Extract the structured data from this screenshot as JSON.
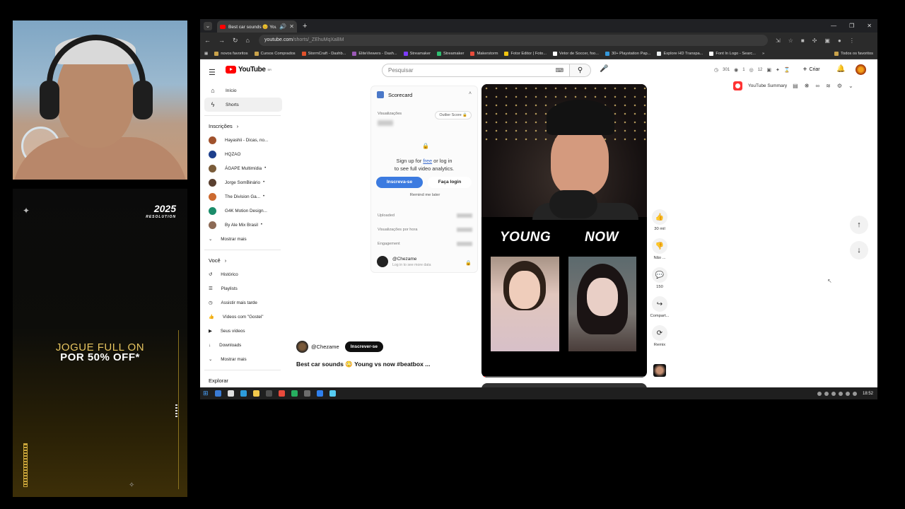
{
  "overlay": {
    "promo_logo_main": "2025",
    "promo_logo_sub": "RESOLUTION",
    "promo_line1": "JOGUE FULL ON",
    "promo_line2": "POR 50% OFF*"
  },
  "browser": {
    "tab_title": "Best car sounds 😊 Young",
    "url_host": "youtube.com",
    "url_path": "/shorts/_ZEhuMqXaBM",
    "bookmarks": [
      {
        "label": "novos favoritos",
        "color": "#c9a24a"
      },
      {
        "label": "Cursos Comprados",
        "color": "#c9a24a"
      },
      {
        "label": "StormCraft - Dashb...",
        "color": "#e0512b"
      },
      {
        "label": "EliteViewers - Dash...",
        "color": "#9b59b6"
      },
      {
        "label": "Streamaker",
        "color": "#7d3cff"
      },
      {
        "label": "Streamaker",
        "color": "#2fbf71"
      },
      {
        "label": "Makerstorm",
        "color": "#e74c3c"
      },
      {
        "label": "Fotor Editor | Foto...",
        "color": "#f1c40f"
      },
      {
        "label": "Vetor de Soccer, foo...",
        "color": "#ffffff"
      },
      {
        "label": "30+ Playstation Pap...",
        "color": "#3498db"
      },
      {
        "label": "Explore HD Transpa...",
        "color": "#ecf0f1"
      },
      {
        "label": "Font In Logo - Searc...",
        "color": "#ffffff"
      }
    ],
    "bookmarks_all": "Todos os favoritos"
  },
  "youtube": {
    "logo_text": "YouTube",
    "logo_region": "BR",
    "search_placeholder": "Pesquisar",
    "stats": [
      "301",
      "1",
      "12"
    ],
    "create_label": "Criar",
    "summary_label": "YouTube Summary",
    "nav": [
      {
        "icon": "home-icon",
        "glyph": "⌂",
        "label": "Início"
      },
      {
        "icon": "shorts-icon",
        "glyph": "ϟ",
        "label": "Shorts"
      }
    ],
    "subs_header": "Inscrições",
    "subscriptions": [
      {
        "label": "Hayashii - Dicas, no...",
        "color": "#a0522d",
        "live": false
      },
      {
        "label": "HQZAO",
        "color": "#1d3f8c",
        "live": false
      },
      {
        "label": "ÁGAPE Multimídia",
        "color": "#7a5c3a",
        "live": true
      },
      {
        "label": "Jorge SomBinário",
        "color": "#5a4030",
        "live": true
      },
      {
        "label": "The Division Ga...",
        "color": "#cc6a30",
        "live": true
      },
      {
        "label": "G4K Motion Design...",
        "color": "#1b8c6a",
        "live": false
      },
      {
        "label": "By Ale Mix Brasil",
        "color": "#8c6a55",
        "live": true
      }
    ],
    "show_more": "Mostrar mais",
    "you_header": "Você",
    "you_items": [
      {
        "icon": "history-icon",
        "glyph": "↺",
        "label": "Histórico"
      },
      {
        "icon": "playlists-icon",
        "glyph": "☰",
        "label": "Playlists"
      },
      {
        "icon": "watch-later-icon",
        "glyph": "◷",
        "label": "Assistir mais tarde"
      },
      {
        "icon": "liked-icon",
        "glyph": "👍",
        "label": "Vídeos com \"Gostei\""
      },
      {
        "icon": "your-videos-icon",
        "glyph": "▶",
        "label": "Seus vídeos"
      },
      {
        "icon": "downloads-icon",
        "glyph": "↓",
        "label": "Downloads"
      }
    ],
    "you_show_more": "Mostrar mais",
    "explore_header": "Explorar",
    "scorecard": {
      "title": "Scorecard",
      "views_label": "Visualizações",
      "outlier_label": "Outlier Score",
      "signup_line1": "Sign up for",
      "signup_free": "free",
      "signup_line1_end": "or log in",
      "signup_line2": "to see full video analytics.",
      "subscribe_button": "Inscreva-se",
      "login_button": "Faça login",
      "remind_label": "Remind me later",
      "rows": [
        "Uploaded",
        "Visualizações por hora",
        "Engagement"
      ],
      "channel_name": "@Chezame",
      "channel_hint": "Log in to see more data"
    },
    "video": {
      "label_left": "YOUNG",
      "label_right": "NOW",
      "progress": 0.02,
      "channel": "@Chezame",
      "subscribe": "Inscrever-se",
      "title": "Best car sounds 😳 Young vs now #beatbox ..."
    },
    "actions": [
      {
        "icon": "like-icon",
        "glyph": "👍",
        "label": "30 mil"
      },
      {
        "icon": "dislike-icon",
        "glyph": "👎",
        "label": "Não ..."
      },
      {
        "icon": "comment-icon",
        "glyph": "💬",
        "label": "150"
      },
      {
        "icon": "share-icon",
        "glyph": "↪",
        "label": "Compart..."
      },
      {
        "icon": "remix-icon",
        "glyph": "⟳",
        "label": "Remix"
      }
    ]
  },
  "taskbar": {
    "time": "18:52",
    "apps": [
      "#3a7bd5",
      "#e0e0e0",
      "#2d9cdb",
      "#f2c94c",
      "#4f4f4f",
      "#e84a3c",
      "#27ae60",
      "#6c6c6c",
      "#2f80ed",
      "#56ccf2"
    ]
  }
}
